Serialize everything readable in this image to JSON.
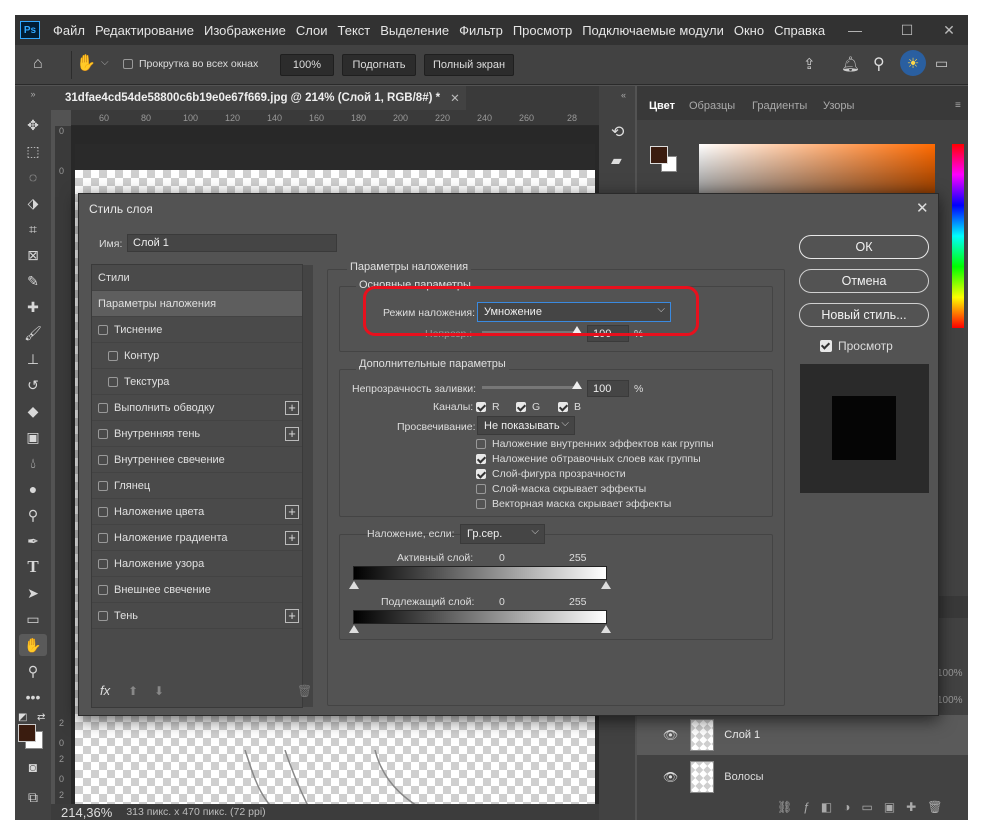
{
  "menubar": {
    "logo": "Ps",
    "items": [
      "Файл",
      "Редактирование",
      "Изображение",
      "Слои",
      "Текст",
      "Выделение",
      "Фильтр",
      "Просмотр",
      "Подключаемые модули",
      "Окно",
      "Справка"
    ]
  },
  "options": {
    "scroll_all": "Прокрутка во всех окнах",
    "zoom_100": "100%",
    "fit": "Подогнать",
    "full_screen": "Полный экран"
  },
  "document": {
    "tab_title": "31dfae4cd54de58800c6b19e0e67f669.jpg @ 214% (Слой 1, RGB/8#) *",
    "ruler_h": [
      "60",
      "80",
      "100",
      "120",
      "140",
      "160",
      "180",
      "200",
      "220",
      "240",
      "260",
      "28"
    ],
    "ruler_v": [
      "0",
      "0",
      "2",
      "0",
      "2",
      "0",
      "2"
    ],
    "zoom": "214,36%",
    "status": "313 пикс. x 470 пикс. (72 ppi)"
  },
  "panels": {
    "color_tabs": [
      "Цвет",
      "Образцы",
      "Градиенты",
      "Узоры"
    ],
    "layer_opacity_1": "100%",
    "layer_opacity_2": "100%",
    "layers": [
      "Слой 1",
      "Волосы"
    ]
  },
  "dialog": {
    "title": "Стиль слоя",
    "name_label": "Имя:",
    "name_value": "Слой 1",
    "styles": [
      {
        "label": "Стили",
        "checkbox": false,
        "plus": false,
        "selected": false,
        "indent": false
      },
      {
        "label": "Параметры наложения",
        "checkbox": false,
        "plus": false,
        "selected": true,
        "indent": false
      },
      {
        "label": "Тиснение",
        "checkbox": true,
        "plus": false,
        "selected": false,
        "indent": false
      },
      {
        "label": "Контур",
        "checkbox": true,
        "plus": false,
        "selected": false,
        "indent": true
      },
      {
        "label": "Текстура",
        "checkbox": true,
        "plus": false,
        "selected": false,
        "indent": true
      },
      {
        "label": "Выполнить обводку",
        "checkbox": true,
        "plus": true,
        "selected": false,
        "indent": false
      },
      {
        "label": "Внутренняя тень",
        "checkbox": true,
        "plus": true,
        "selected": false,
        "indent": false
      },
      {
        "label": "Внутреннее свечение",
        "checkbox": true,
        "plus": false,
        "selected": false,
        "indent": false
      },
      {
        "label": "Глянец",
        "checkbox": true,
        "plus": false,
        "selected": false,
        "indent": false
      },
      {
        "label": "Наложение цвета",
        "checkbox": true,
        "plus": true,
        "selected": false,
        "indent": false
      },
      {
        "label": "Наложение градиента",
        "checkbox": true,
        "plus": true,
        "selected": false,
        "indent": false
      },
      {
        "label": "Наложение узора",
        "checkbox": true,
        "plus": false,
        "selected": false,
        "indent": false
      },
      {
        "label": "Внешнее свечение",
        "checkbox": true,
        "plus": false,
        "selected": false,
        "indent": false
      },
      {
        "label": "Тень",
        "checkbox": true,
        "plus": true,
        "selected": false,
        "indent": false
      }
    ],
    "blend_section": "Параметры наложения",
    "basic_params": "Основные параметры",
    "blend_mode_label": "Режим наложения:",
    "blend_mode_value": "Умножение",
    "opacity_label": "Непрозр.:",
    "opacity_value": "100",
    "percent": "%",
    "advanced": "Дополнительные параметры",
    "fill_opacity_label": "Непрозрачность заливки:",
    "fill_opacity_value": "100",
    "channels_label": "Каналы:",
    "channels": [
      "R",
      "G",
      "B"
    ],
    "knockout_label": "Просвечивание:",
    "knockout_value": "Не показывать",
    "options": [
      {
        "label": "Наложение внутренних эффектов как группы",
        "checked": false
      },
      {
        "label": "Наложение обтравочных слоев как группы",
        "checked": true
      },
      {
        "label": "Слой-фигура прозрачности",
        "checked": true
      },
      {
        "label": "Слой-маска скрывает эффекты",
        "checked": false
      },
      {
        "label": "Векторная маска скрывает эффекты",
        "checked": false
      }
    ],
    "blend_if_label": "Наложение, если:",
    "blend_if_value": "Гр.сер.",
    "this_layer": "Активный слой:",
    "underlying": "Подлежащий слой:",
    "min": "0",
    "max": "255",
    "ok": "ОК",
    "cancel": "Отмена",
    "new_style": "Новый стиль...",
    "preview": "Просмотр",
    "fx": "fx"
  },
  "colors": {
    "highlight": "#e8101d",
    "accent": "#31a8ff",
    "fg_swatch": "#3a1c0f"
  }
}
